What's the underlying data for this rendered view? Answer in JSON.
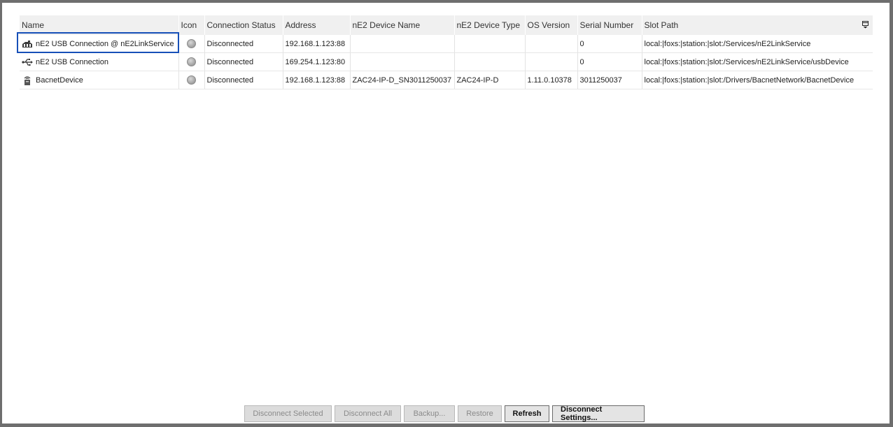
{
  "table": {
    "columns": [
      "Name",
      "Icon",
      "Connection Status",
      "Address",
      "nE2 Device Name",
      "nE2 Device Type",
      "OS Version",
      "Serial Number",
      "Slot Path"
    ],
    "rows": [
      {
        "name": "nE2 USB Connection @ nE2LinkService",
        "icon": "link-service-icon",
        "status": "Disconnected",
        "address": "192.168.1.123:88",
        "device_name": "",
        "device_type": "",
        "os_version": "",
        "serial": "0",
        "slot_path": "local:|foxs:|station:|slot:/Services/nE2LinkService"
      },
      {
        "name": "nE2 USB Connection",
        "icon": "usb-icon",
        "status": "Disconnected",
        "address": "169.254.1.123:80",
        "device_name": "",
        "device_type": "",
        "os_version": "",
        "serial": "0",
        "slot_path": "local:|foxs:|station:|slot:/Services/nE2LinkService/usbDevice"
      },
      {
        "name": "BacnetDevice",
        "icon": "bacnet-device-icon",
        "status": "Disconnected",
        "address": "192.168.1.123:88",
        "device_name": "ZAC24-IP-D_SN3011250037",
        "device_type": "ZAC24-IP-D",
        "os_version": "1.11.0.10378",
        "serial": "3011250037",
        "slot_path": "local:|foxs:|station:|slot:/Drivers/BacnetNetwork/BacnetDevice"
      }
    ]
  },
  "buttons": {
    "disconnect_selected": "Disconnect Selected",
    "disconnect_all": "Disconnect All",
    "backup": "Backup...",
    "restore": "Restore",
    "refresh": "Refresh",
    "disconnect_settings": "Disconnect Settings..."
  },
  "colors": {
    "selection_outline": "#1750b8",
    "header_bg": "#f0f0f0",
    "status_dot": "#a8a8a8"
  }
}
